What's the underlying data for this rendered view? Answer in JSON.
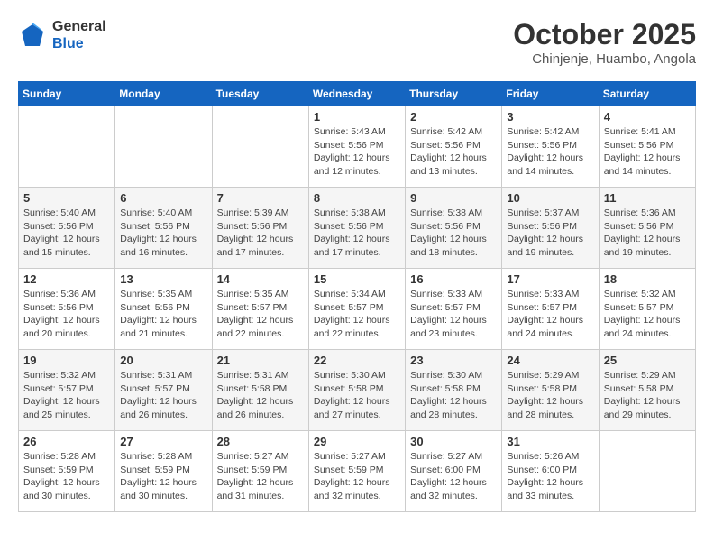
{
  "logo": {
    "general": "General",
    "blue": "Blue"
  },
  "title": "October 2025",
  "subtitle": "Chinjenje, Huambo, Angola",
  "days_header": [
    "Sunday",
    "Monday",
    "Tuesday",
    "Wednesday",
    "Thursday",
    "Friday",
    "Saturday"
  ],
  "weeks": [
    [
      {
        "day": "",
        "info": ""
      },
      {
        "day": "",
        "info": ""
      },
      {
        "day": "",
        "info": ""
      },
      {
        "day": "1",
        "info": "Sunrise: 5:43 AM\nSunset: 5:56 PM\nDaylight: 12 hours and 12 minutes."
      },
      {
        "day": "2",
        "info": "Sunrise: 5:42 AM\nSunset: 5:56 PM\nDaylight: 12 hours and 13 minutes."
      },
      {
        "day": "3",
        "info": "Sunrise: 5:42 AM\nSunset: 5:56 PM\nDaylight: 12 hours and 14 minutes."
      },
      {
        "day": "4",
        "info": "Sunrise: 5:41 AM\nSunset: 5:56 PM\nDaylight: 12 hours and 14 minutes."
      }
    ],
    [
      {
        "day": "5",
        "info": "Sunrise: 5:40 AM\nSunset: 5:56 PM\nDaylight: 12 hours and 15 minutes."
      },
      {
        "day": "6",
        "info": "Sunrise: 5:40 AM\nSunset: 5:56 PM\nDaylight: 12 hours and 16 minutes."
      },
      {
        "day": "7",
        "info": "Sunrise: 5:39 AM\nSunset: 5:56 PM\nDaylight: 12 hours and 17 minutes."
      },
      {
        "day": "8",
        "info": "Sunrise: 5:38 AM\nSunset: 5:56 PM\nDaylight: 12 hours and 17 minutes."
      },
      {
        "day": "9",
        "info": "Sunrise: 5:38 AM\nSunset: 5:56 PM\nDaylight: 12 hours and 18 minutes."
      },
      {
        "day": "10",
        "info": "Sunrise: 5:37 AM\nSunset: 5:56 PM\nDaylight: 12 hours and 19 minutes."
      },
      {
        "day": "11",
        "info": "Sunrise: 5:36 AM\nSunset: 5:56 PM\nDaylight: 12 hours and 19 minutes."
      }
    ],
    [
      {
        "day": "12",
        "info": "Sunrise: 5:36 AM\nSunset: 5:56 PM\nDaylight: 12 hours and 20 minutes."
      },
      {
        "day": "13",
        "info": "Sunrise: 5:35 AM\nSunset: 5:56 PM\nDaylight: 12 hours and 21 minutes."
      },
      {
        "day": "14",
        "info": "Sunrise: 5:35 AM\nSunset: 5:57 PM\nDaylight: 12 hours and 22 minutes."
      },
      {
        "day": "15",
        "info": "Sunrise: 5:34 AM\nSunset: 5:57 PM\nDaylight: 12 hours and 22 minutes."
      },
      {
        "day": "16",
        "info": "Sunrise: 5:33 AM\nSunset: 5:57 PM\nDaylight: 12 hours and 23 minutes."
      },
      {
        "day": "17",
        "info": "Sunrise: 5:33 AM\nSunset: 5:57 PM\nDaylight: 12 hours and 24 minutes."
      },
      {
        "day": "18",
        "info": "Sunrise: 5:32 AM\nSunset: 5:57 PM\nDaylight: 12 hours and 24 minutes."
      }
    ],
    [
      {
        "day": "19",
        "info": "Sunrise: 5:32 AM\nSunset: 5:57 PM\nDaylight: 12 hours and 25 minutes."
      },
      {
        "day": "20",
        "info": "Sunrise: 5:31 AM\nSunset: 5:57 PM\nDaylight: 12 hours and 26 minutes."
      },
      {
        "day": "21",
        "info": "Sunrise: 5:31 AM\nSunset: 5:58 PM\nDaylight: 12 hours and 26 minutes."
      },
      {
        "day": "22",
        "info": "Sunrise: 5:30 AM\nSunset: 5:58 PM\nDaylight: 12 hours and 27 minutes."
      },
      {
        "day": "23",
        "info": "Sunrise: 5:30 AM\nSunset: 5:58 PM\nDaylight: 12 hours and 28 minutes."
      },
      {
        "day": "24",
        "info": "Sunrise: 5:29 AM\nSunset: 5:58 PM\nDaylight: 12 hours and 28 minutes."
      },
      {
        "day": "25",
        "info": "Sunrise: 5:29 AM\nSunset: 5:58 PM\nDaylight: 12 hours and 29 minutes."
      }
    ],
    [
      {
        "day": "26",
        "info": "Sunrise: 5:28 AM\nSunset: 5:59 PM\nDaylight: 12 hours and 30 minutes."
      },
      {
        "day": "27",
        "info": "Sunrise: 5:28 AM\nSunset: 5:59 PM\nDaylight: 12 hours and 30 minutes."
      },
      {
        "day": "28",
        "info": "Sunrise: 5:27 AM\nSunset: 5:59 PM\nDaylight: 12 hours and 31 minutes."
      },
      {
        "day": "29",
        "info": "Sunrise: 5:27 AM\nSunset: 5:59 PM\nDaylight: 12 hours and 32 minutes."
      },
      {
        "day": "30",
        "info": "Sunrise: 5:27 AM\nSunset: 6:00 PM\nDaylight: 12 hours and 32 minutes."
      },
      {
        "day": "31",
        "info": "Sunrise: 5:26 AM\nSunset: 6:00 PM\nDaylight: 12 hours and 33 minutes."
      },
      {
        "day": "",
        "info": ""
      }
    ]
  ]
}
